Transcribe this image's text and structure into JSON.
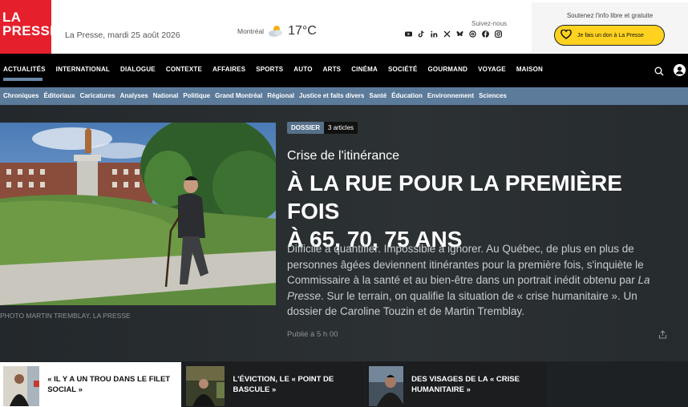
{
  "header": {
    "logo_line1": "LA",
    "logo_line2": "PRESSE",
    "dateline": "La Presse, mardi 25 août 2026",
    "weather_city": "Montréal",
    "weather_temp": "17°C",
    "follow_label": "Suivez-nous",
    "support_label": "Soutenez l'info libre et gratuite",
    "donate_button": "Je fais un don à La Presse"
  },
  "nav_primary": [
    "ACTUALITÉS",
    "INTERNATIONAL",
    "DIALOGUE",
    "CONTEXTE",
    "AFFAIRES",
    "SPORTS",
    "AUTO",
    "ARTS",
    "CINÉMA",
    "SOCIÉTÉ",
    "GOURMAND",
    "VOYAGE",
    "MAISON"
  ],
  "nav_secondary": [
    "Chroniques",
    "Éditoriaux",
    "Caricatures",
    "Analyses",
    "National",
    "Politique",
    "Grand Montréal",
    "Régional",
    "Justice et faits divers",
    "Santé",
    "Éducation",
    "Environnement",
    "Sciences"
  ],
  "hero": {
    "photo_caption": "PHOTO MARTIN TREMBLAY, LA PRESSE",
    "badge_tag": "DOSSIER",
    "badge_count": "3 articles",
    "kicker": "Crise de l'itinérance",
    "headline_line1": "À LA RUE POUR LA PREMIÈRE FOIS",
    "headline_line2": "À 65, 70, 75 ANS",
    "lede_part1": "Difficile à quantifier. Impossible à ignorer. Au Québec, de plus en plus de personnes âgées deviennent itinérantes pour la première fois, s'inquiète le Commissaire à la santé et au bien-être dans un portrait inédit obtenu par",
    "lede_publication": "La Presse",
    "lede_part2": ". Sur le terrain, on qualifie la situation de « crise humanitaire ». Un dossier de Caroline Touzin et de Martin Tremblay.",
    "published": "Publié à 5 h 00"
  },
  "related": [
    {
      "title": "« IL Y A UN TROU DANS LE FILET SOCIAL »"
    },
    {
      "title": "L'ÉVICTION, LE « POINT DE BASCULE »"
    },
    {
      "title": "DES VISAGES DE LA « CRISE HUMANITAIRE »"
    }
  ],
  "icons": {
    "socials": [
      "youtube-icon",
      "tiktok-icon",
      "linkedin-icon",
      "x-icon",
      "bluesky-icon",
      "threads-icon",
      "facebook-icon",
      "instagram-icon"
    ],
    "weather": "partly-cloudy-icon",
    "search": "search-icon",
    "account": "user-icon",
    "share": "share-icon",
    "donate": "heart-icon"
  },
  "colors": {
    "brand_red": "#e5202c",
    "nav_secondary": "#5c7a9a",
    "donate_yellow": "#ffd21f",
    "dossier_badge": "#57708a"
  }
}
